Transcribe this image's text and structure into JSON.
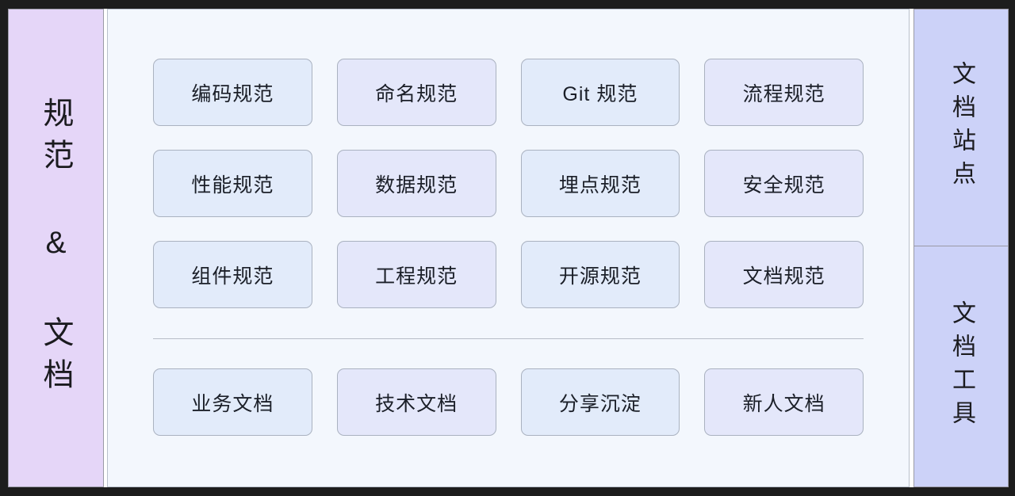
{
  "diagram": {
    "left_section": {
      "label": "规范 & 文档",
      "bg_color": "#e5d6f8"
    },
    "main_panel": {
      "bg_color": "#f3f7fd",
      "standards_cards": [
        {
          "label": "编码规范",
          "tint": "blue"
        },
        {
          "label": "命名规范",
          "tint": "violet"
        },
        {
          "label": "Git 规范",
          "tint": "blue"
        },
        {
          "label": "流程规范",
          "tint": "violet"
        },
        {
          "label": "性能规范",
          "tint": "blue"
        },
        {
          "label": "数据规范",
          "tint": "violet"
        },
        {
          "label": "埋点规范",
          "tint": "blue"
        },
        {
          "label": "安全规范",
          "tint": "violet"
        },
        {
          "label": "组件规范",
          "tint": "blue"
        },
        {
          "label": "工程规范",
          "tint": "violet"
        },
        {
          "label": "开源规范",
          "tint": "blue"
        },
        {
          "label": "文档规范",
          "tint": "violet"
        }
      ],
      "document_cards": [
        {
          "label": "业务文档",
          "tint": "blue"
        },
        {
          "label": "技术文档",
          "tint": "violet"
        },
        {
          "label": "分享沉淀",
          "tint": "blue"
        },
        {
          "label": "新人文档",
          "tint": "violet"
        }
      ]
    },
    "right_sections": [
      {
        "label": "文档站点",
        "bg_color": "#ccd2f8"
      },
      {
        "label": "文档工具",
        "bg_color": "#ccd2f8"
      }
    ]
  }
}
